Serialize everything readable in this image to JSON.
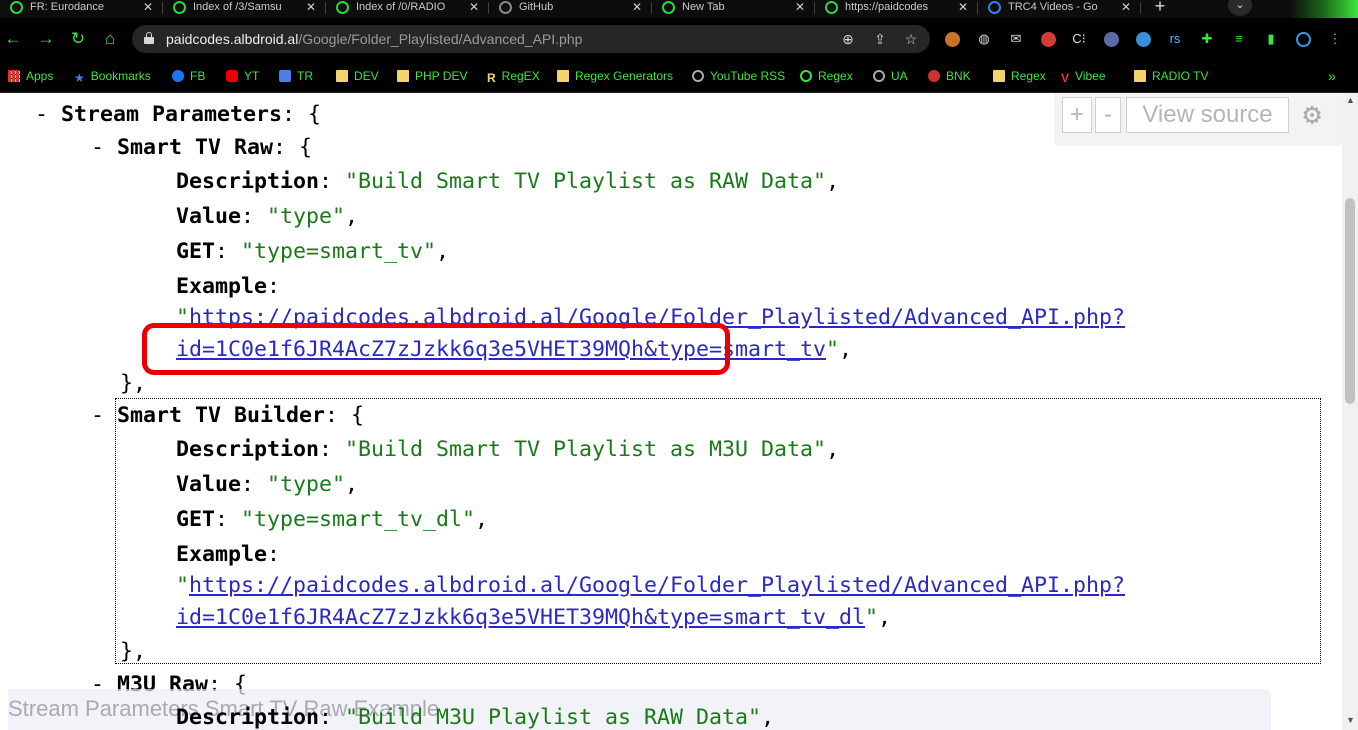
{
  "browser": {
    "tabs": [
      {
        "title": "FR: Eurodance"
      },
      {
        "title": "Index of /3/Samsu"
      },
      {
        "title": "Index of /0/RADIO"
      },
      {
        "title": "GitHub"
      },
      {
        "title": "New Tab"
      },
      {
        "title": "https://paidcodes"
      },
      {
        "title": "TRC4 Videos - Go"
      }
    ],
    "new_tab_label": "+",
    "url_host": "paidcodes.albdroid.al",
    "url_path": "/Google/Folder_Playlisted/Advanced_API.php",
    "nav": {
      "back": "←",
      "forward": "→",
      "reload": "↻",
      "home": "⌂"
    },
    "omnibox_icons": [
      "zoom-icon",
      "share-icon",
      "star-icon"
    ],
    "extensions": [
      "code-ext",
      "globe-ext",
      "mail-ext",
      "red-ext",
      "cs-ext",
      "cursor-ext",
      "earth-ext",
      "rs-ext",
      "puzzle-ext",
      "playlist-ext",
      "sidepanel-ext",
      "profile-ext",
      "menu-ext"
    ],
    "ext_labels": {
      "cs": "C⁝",
      "rs": "rs",
      "menu": "⋮"
    },
    "bookmarks": [
      {
        "label": "Apps",
        "icon": "apps-grid-icon"
      },
      {
        "label": "Bookmarks",
        "icon": "star-icon"
      },
      {
        "label": "FB",
        "icon": "facebook-icon"
      },
      {
        "label": "YT",
        "icon": "youtube-icon"
      },
      {
        "label": "TR",
        "icon": "translate-icon"
      },
      {
        "label": "DEV",
        "icon": "folder-icon"
      },
      {
        "label": "PHP DEV",
        "icon": "folder-icon"
      },
      {
        "label": "RegEX",
        "icon": "r-icon"
      },
      {
        "label": "Regex Generators",
        "icon": "folder-icon"
      },
      {
        "label": "YouTube RSS",
        "icon": "globe-icon"
      },
      {
        "label": "Regex",
        "icon": "play-circle-icon"
      },
      {
        "label": "UA",
        "icon": "globe-icon"
      },
      {
        "label": "BNK",
        "icon": "bank-icon"
      },
      {
        "label": "Regex",
        "icon": "folder-icon"
      },
      {
        "label": "Vibee",
        "icon": "v-icon"
      },
      {
        "label": "RADIO TV",
        "icon": "folder-icon"
      }
    ],
    "bookmarks_more": "»"
  },
  "viewer": {
    "controls": {
      "expand": "+",
      "collapse": "-",
      "view_source": "View source"
    },
    "breadcrumb": "Stream Parameters Smart TV Raw Example",
    "lines": {
      "stream_dash": "- ",
      "stream_key": "Stream Parameters",
      "stream_open": ": {",
      "raw_dash": "- ",
      "raw_key": "Smart TV Raw",
      "raw_open": ": {",
      "raw_desc_key": "Description",
      "raw_desc_val": "\"Build Smart TV Playlist as RAW Data\"",
      "raw_value_key": "Value",
      "raw_value_val": "\"type\"",
      "raw_get_key": "GET",
      "raw_get_val": "\"type=smart_tv\"",
      "raw_example_key": "Example",
      "raw_url_line1": "https://paidcodes.albdroid.al/Google/Folder_Playlisted/Advanced_API.php?",
      "raw_url_line2": "id=1C0e1f6JR4AcZ7zJzkk6q3e5VHET39MQh&type=smart_tv",
      "raw_close": "},",
      "builder_dash": "- ",
      "builder_key": "Smart TV Builder",
      "builder_open": ": {",
      "builder_desc_key": "Description",
      "builder_desc_val": "\"Build Smart TV Playlist as M3U Data\"",
      "builder_value_key": "Value",
      "builder_value_val": "\"type\"",
      "builder_get_key": "GET",
      "builder_get_val": "\"type=smart_tv_dl\"",
      "builder_example_key": "Example",
      "builder_url_line1": "https://paidcodes.albdroid.al/Google/Folder_Playlisted/Advanced_API.php?",
      "builder_url_line2": "id=1C0e1f6JR4AcZ7zJzkk6q3e5VHET39MQh&type=smart_tv_dl",
      "builder_close": "},",
      "m3u_dash": "- ",
      "m3u_key": "M3U Raw",
      "m3u_open": ": {",
      "m3u_desc_key": "Description",
      "m3u_desc_val": "\"Build M3U Playlist as RAW Data\""
    }
  },
  "colors": {
    "string": "#1a7a1a",
    "link": "#2929c5",
    "highlight": "#e80000",
    "accent": "#3be33b"
  }
}
